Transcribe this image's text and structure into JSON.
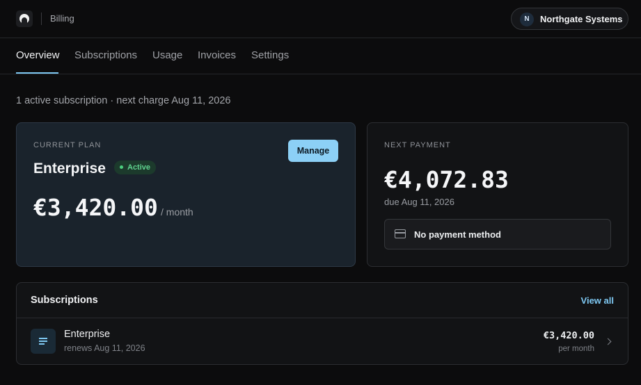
{
  "header": {
    "title": "Billing",
    "org": {
      "initial": "N",
      "name": "Northgate Systems"
    }
  },
  "tabs": [
    {
      "label": "Overview",
      "active": true
    },
    {
      "label": "Subscriptions"
    },
    {
      "label": "Usage"
    },
    {
      "label": "Invoices"
    },
    {
      "label": "Settings"
    }
  ],
  "summary": "1 active subscription · next charge Aug 11, 2026",
  "current_plan": {
    "eyebrow": "CURRENT PLAN",
    "name": "Enterprise",
    "status": "Active",
    "manage_label": "Manage",
    "amount": "€3,420.00",
    "period": "/ month"
  },
  "next_payment": {
    "eyebrow": "NEXT PAYMENT",
    "amount": "€4,072.83",
    "due": "due Aug 11, 2026",
    "method": "No payment method"
  },
  "subscriptions": {
    "title": "Subscriptions",
    "view_all": "View all",
    "rows": [
      {
        "name": "Enterprise",
        "renews": "renews Aug 11, 2026",
        "amount": "€3,420.00",
        "period": "per month"
      }
    ]
  },
  "colors": {
    "accent": "#7ec8f2",
    "active_badge": "#5fd28f",
    "background": "#0c0c0d"
  }
}
